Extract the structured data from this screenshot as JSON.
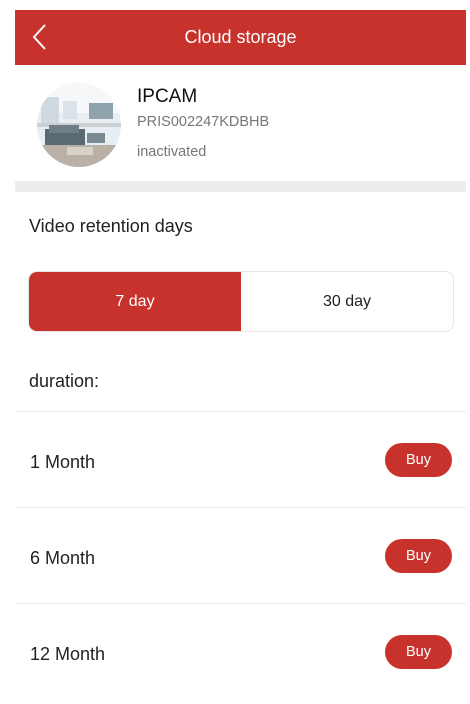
{
  "header": {
    "title": "Cloud storage",
    "back_icon": "chevron-left-icon"
  },
  "device": {
    "name": "IPCAM",
    "serial": "PRIS002247KDBHB",
    "status": "inactivated"
  },
  "retention": {
    "title": "Video retention days",
    "options": [
      {
        "label": "7 day",
        "selected": true
      },
      {
        "label": "30 day",
        "selected": false
      }
    ]
  },
  "duration": {
    "label": "duration:",
    "plans": [
      {
        "label": "1 Month",
        "buy_label": "Buy"
      },
      {
        "label": "6 Month",
        "buy_label": "Buy"
      },
      {
        "label": "12 Month",
        "buy_label": "Buy"
      }
    ]
  },
  "colors": {
    "accent": "#c7332c",
    "separator": "#ededed"
  }
}
